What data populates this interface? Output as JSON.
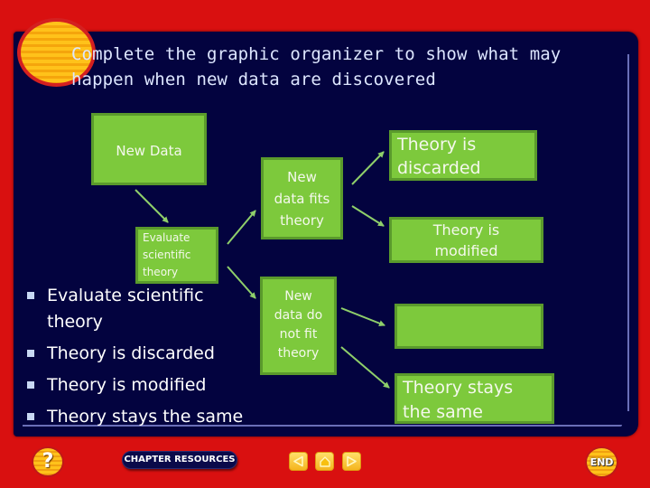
{
  "title": {
    "line1": "Complete the graphic organizer to show what may",
    "line2": "happen when new data are discovered"
  },
  "organizer": {
    "new_data": "New Data",
    "evaluate": [
      "Evaluate",
      "scientific",
      "theory"
    ],
    "fits": [
      "New",
      "data fits",
      "theory"
    ],
    "discarded": [
      "Theory is",
      "discarded"
    ],
    "modified": [
      "Theory is",
      "modified"
    ],
    "not_fit": [
      "New",
      "data do",
      "not fit",
      "theory"
    ],
    "empty": "",
    "stays": [
      "Theory stays",
      "the same"
    ]
  },
  "answer_list": {
    "items": [
      "Evaluate scientific theory",
      "Theory is discarded",
      "Theory is modified",
      "Theory stays the same"
    ]
  },
  "toolbar": {
    "help_label": "?",
    "chapter_resources_label": "CHAPTER RESOURCES",
    "prev_icon": "triangle-left",
    "home_icon": "house",
    "next_icon": "triangle-right",
    "end_label": "END"
  },
  "colors": {
    "background": "#d91010",
    "panel": "#03033f",
    "box_fill": "#7dc93c",
    "box_border": "#5a9a2c",
    "arrow": "#8fcf6a",
    "title_text": "#dde6ff"
  }
}
